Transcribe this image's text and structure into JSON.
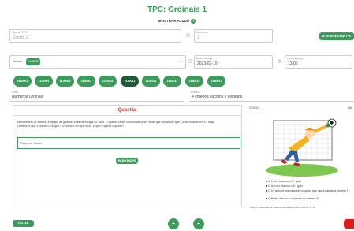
{
  "header": {
    "title": "TPC: Ordinais 1",
    "help_label": "MOSTRAR AJUDA",
    "help_icon": "?"
  },
  "form": {
    "tipo": {
      "label": "Tipo de TPC",
      "value": "Escrita 1"
    },
    "semana": {
      "label": "Semana",
      "value": "2"
    },
    "criar_button": "CRIAR/EDITAR TPC",
    "turmas": {
      "label": "Turmas",
      "tag": "2140245"
    },
    "data": {
      "label": "Data entrega",
      "value": "2023-02-10"
    },
    "hora": {
      "label": "Hora entrega",
      "value": "13:00"
    },
    "tema": {
      "label": "Tema",
      "value": "Números Ordinais"
    },
    "criterio": {
      "label": "Critério",
      "value": "4 critérios escritos e exibidos"
    }
  },
  "pills": [
    {
      "label": "2140001",
      "active": false
    },
    {
      "label": "2140002",
      "active": false
    },
    {
      "label": "2140003",
      "active": false
    },
    {
      "label": "2140004",
      "active": false
    },
    {
      "label": "2140005",
      "active": false
    },
    {
      "label": "2140011",
      "active": true
    },
    {
      "label": "2140013",
      "active": false
    },
    {
      "label": "2140014",
      "active": false
    },
    {
      "label": "2140015",
      "active": false
    },
    {
      "label": "2140017",
      "active": false
    }
  ],
  "question": {
    "heading": "Questão",
    "text": "Num torneio de futebol, a equipa da guarda-redes da equipa do João. O guarda-redes convocada pela Paula, que conseguiu que Carlos ficasse em 4.º lugar. Lembra-te que o número a seguir é o número em que ficou. E que o quinto é quinto?",
    "answer_placeholder": "Resposta: Fausto",
    "submit_label": "RESPONDER"
  },
  "side": {
    "code": "2140011",
    "tag": "MA",
    "options": [
      "O Pedro marcou o 1.º golo.",
      "O Ivo não marcou o 3.º golo.",
      "O 3.º golo foi marcado pelo jogador que usa a camisola número 5.",
      "O Pedro não foi o vencedor do número 5."
    ],
    "footer": "Imagem: Adaptado de www.escolamagica.pt 2012-01-13 19:32"
  },
  "footer": {
    "back_label": "VOLTAR",
    "plus_left": "+",
    "plus_right": "+"
  },
  "colors": {
    "accent": "#3c9c5b",
    "accent_dark": "#1f5a36",
    "heading_red": "#c43030",
    "close_red": "#e0191b"
  }
}
